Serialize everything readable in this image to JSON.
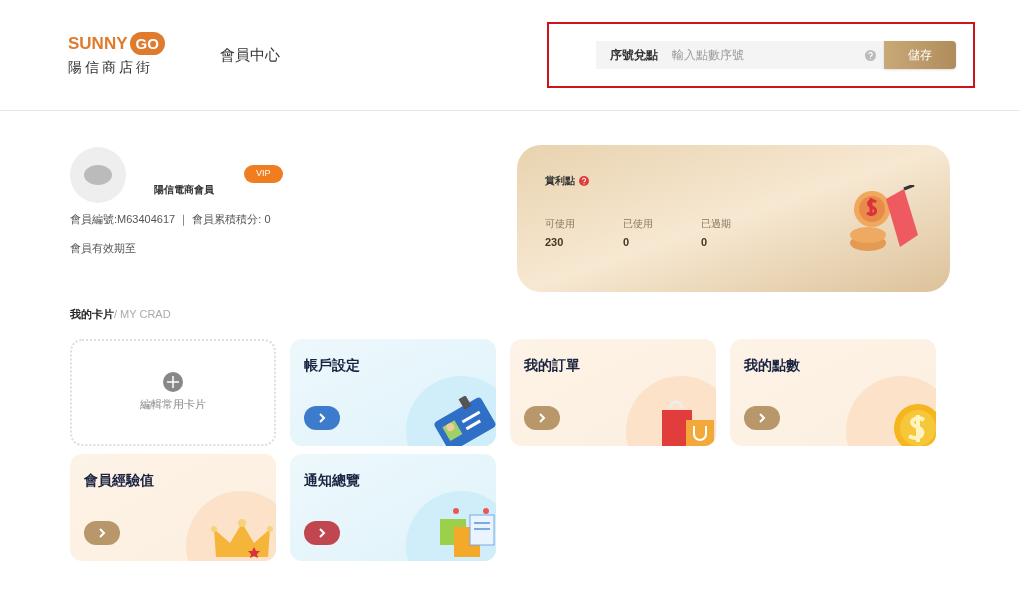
{
  "header": {
    "logo": {
      "word": "SUNNY",
      "mark": "GO",
      "subtitle": "陽信商店街"
    },
    "title": "會員中心",
    "redeem": {
      "label": "序號兌點",
      "placeholder": "輸入點數序號",
      "button": "儲存",
      "highlighted": true
    }
  },
  "member": {
    "name": "陽信電商會員",
    "badge": "VIP",
    "id_line": "會員編號:M63404617 ｜ 會員累積積分: 0",
    "expiry": "會員有效期至"
  },
  "points": {
    "title": "賞利點",
    "stats": [
      {
        "label": "可使用",
        "value": "230"
      },
      {
        "label": "已使用",
        "value": "0"
      },
      {
        "label": "已過期",
        "value": "0"
      }
    ]
  },
  "cards_section": {
    "title": "我的卡片",
    "subtitle": "/ MY CRAD"
  },
  "cards": [
    {
      "kind": "add",
      "label": "編輯常用卡片"
    },
    {
      "kind": "link",
      "label": "帳戶設定",
      "color": "#3d7ccc"
    },
    {
      "kind": "link",
      "label": "我的訂單",
      "color": "#b8976a"
    },
    {
      "kind": "link",
      "label": "我的點數",
      "color": "#b8976a"
    },
    {
      "kind": "link",
      "label": "會員經驗值",
      "color": "#b8976a"
    },
    {
      "kind": "link",
      "label": "通知總覽",
      "color": "#c0474f"
    }
  ]
}
